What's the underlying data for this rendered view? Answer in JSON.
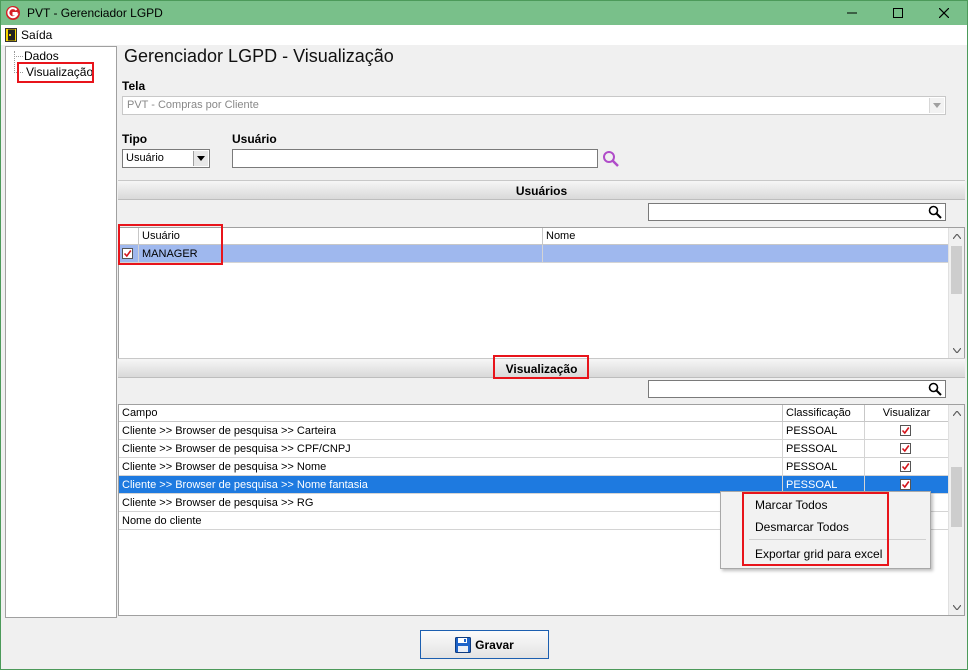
{
  "window": {
    "title": "PVT - Gerenciador LGPD",
    "minimize_icon": "minimize-icon",
    "maximize_icon": "maximize-icon",
    "close_icon": "close-icon",
    "titlebar_color": "#79c08a"
  },
  "menu": {
    "exit_label": "Saída",
    "exit_icon": "door-exit-icon"
  },
  "tree": {
    "items": [
      {
        "label": "Dados"
      },
      {
        "label": "Visualização"
      }
    ]
  },
  "page": {
    "title": "Gerenciador LGPD - Visualização"
  },
  "tela": {
    "label": "Tela",
    "value": "PVT - Compras por Cliente"
  },
  "tipo": {
    "label": "Tipo",
    "value": "Usuário"
  },
  "usuario": {
    "label": "Usuário",
    "value": "",
    "search_icon": "magnifier-icon"
  },
  "users_section": {
    "title": "Usuários",
    "filter_value": "",
    "columns": [
      "Usuário",
      "Nome"
    ],
    "rows": [
      {
        "checked": true,
        "usuario": "MANAGER",
        "nome": ""
      }
    ]
  },
  "view_section": {
    "title": "Visualização",
    "filter_value": "",
    "columns": [
      "Campo",
      "Classificação",
      "Visualizar"
    ],
    "rows": [
      {
        "campo": "Cliente >> Browser de pesquisa >> Carteira",
        "classificacao": "PESSOAL",
        "visualizar": true
      },
      {
        "campo": "Cliente >> Browser de pesquisa >> CPF/CNPJ",
        "classificacao": "PESSOAL",
        "visualizar": true
      },
      {
        "campo": "Cliente >> Browser de pesquisa >> Nome",
        "classificacao": "PESSOAL",
        "visualizar": true
      },
      {
        "campo": "Cliente >> Browser de pesquisa >> Nome fantasia",
        "classificacao": "PESSOAL",
        "visualizar": true
      },
      {
        "campo": "Cliente >> Browser de pesquisa >> RG",
        "classificacao": "",
        "visualizar": false
      },
      {
        "campo": "Nome do cliente",
        "classificacao": "",
        "visualizar": false
      }
    ]
  },
  "context_menu": {
    "items": [
      "Marcar Todos",
      "Desmarcar Todos",
      "Exportar grid para excel"
    ]
  },
  "footer": {
    "save_label": "Gravar",
    "save_icon": "floppy-disk-icon"
  },
  "colors": {
    "highlight_box": "#e8141b",
    "selected_row_light": "#9fb8ee",
    "selected_row_dark": "#1e7ae0"
  }
}
